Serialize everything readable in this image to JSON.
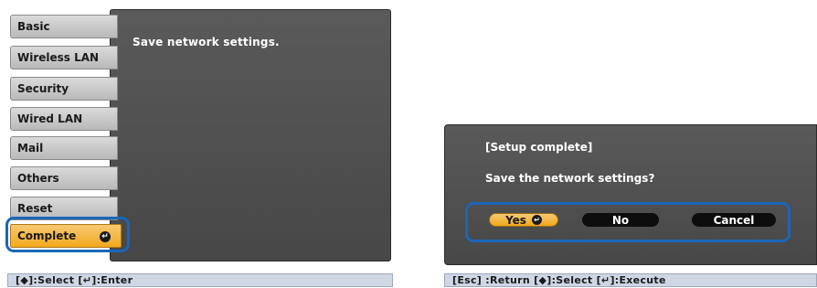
{
  "left": {
    "menu_items": [
      {
        "label": "Basic"
      },
      {
        "label": "Wireless LAN"
      },
      {
        "label": "Security"
      },
      {
        "label": "Wired LAN"
      },
      {
        "label": "Mail"
      },
      {
        "label": "Others"
      },
      {
        "label": "Reset"
      },
      {
        "label": "Complete",
        "selected": true,
        "icon": "enter-icon"
      }
    ],
    "message": "Save network settings.",
    "hint": "[◆]:Select  [↵]:Enter"
  },
  "dialog": {
    "title": "[Setup complete]",
    "question": "Save the network settings?",
    "buttons": {
      "yes": "Yes",
      "no": "No",
      "cancel": "Cancel"
    },
    "hint": "[Esc] :Return  [◆]:Select  [↵]:Execute"
  },
  "colors": {
    "highlight": "#1a66b8",
    "selected": "#f2a91d",
    "panel": "#4f4f4f"
  }
}
